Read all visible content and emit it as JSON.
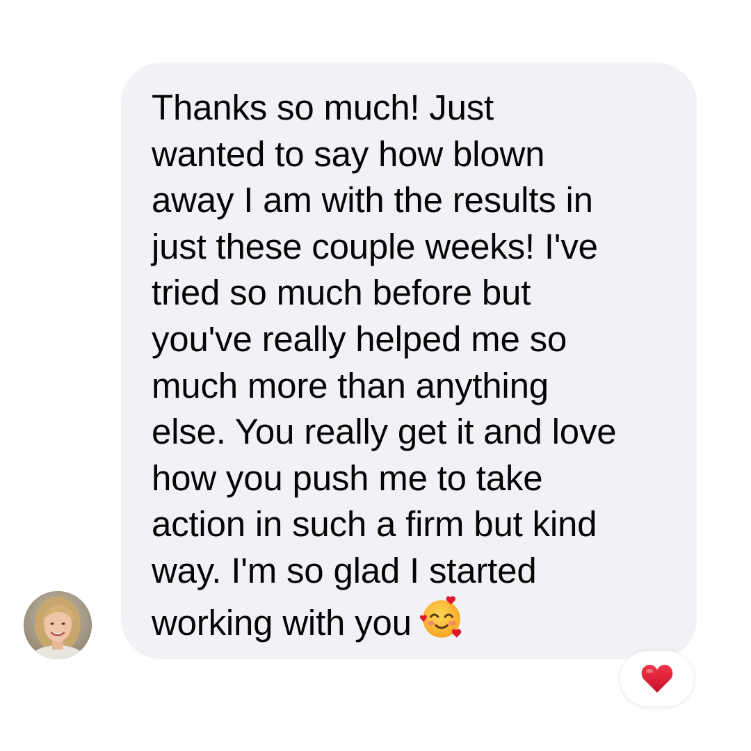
{
  "message": {
    "lines": [
      "Thanks so much! Just",
      "wanted to say how blown",
      "away I am with the results in",
      "just these couple weeks! I've",
      "tried so much before but",
      "you've really helped me so",
      "much more than anything",
      "else. You really get it and love",
      "how you push me to take",
      "action in such a firm but kind",
      "way. I'm so glad I started",
      "working with you"
    ],
    "emoji": "smiling-face-with-hearts-icon"
  },
  "reaction": {
    "icon": "red-heart-icon"
  },
  "colors": {
    "bubble": "#f0f2f5",
    "text": "#050505",
    "heart": "#e0182d",
    "emoji_face": "#ffc93c"
  }
}
